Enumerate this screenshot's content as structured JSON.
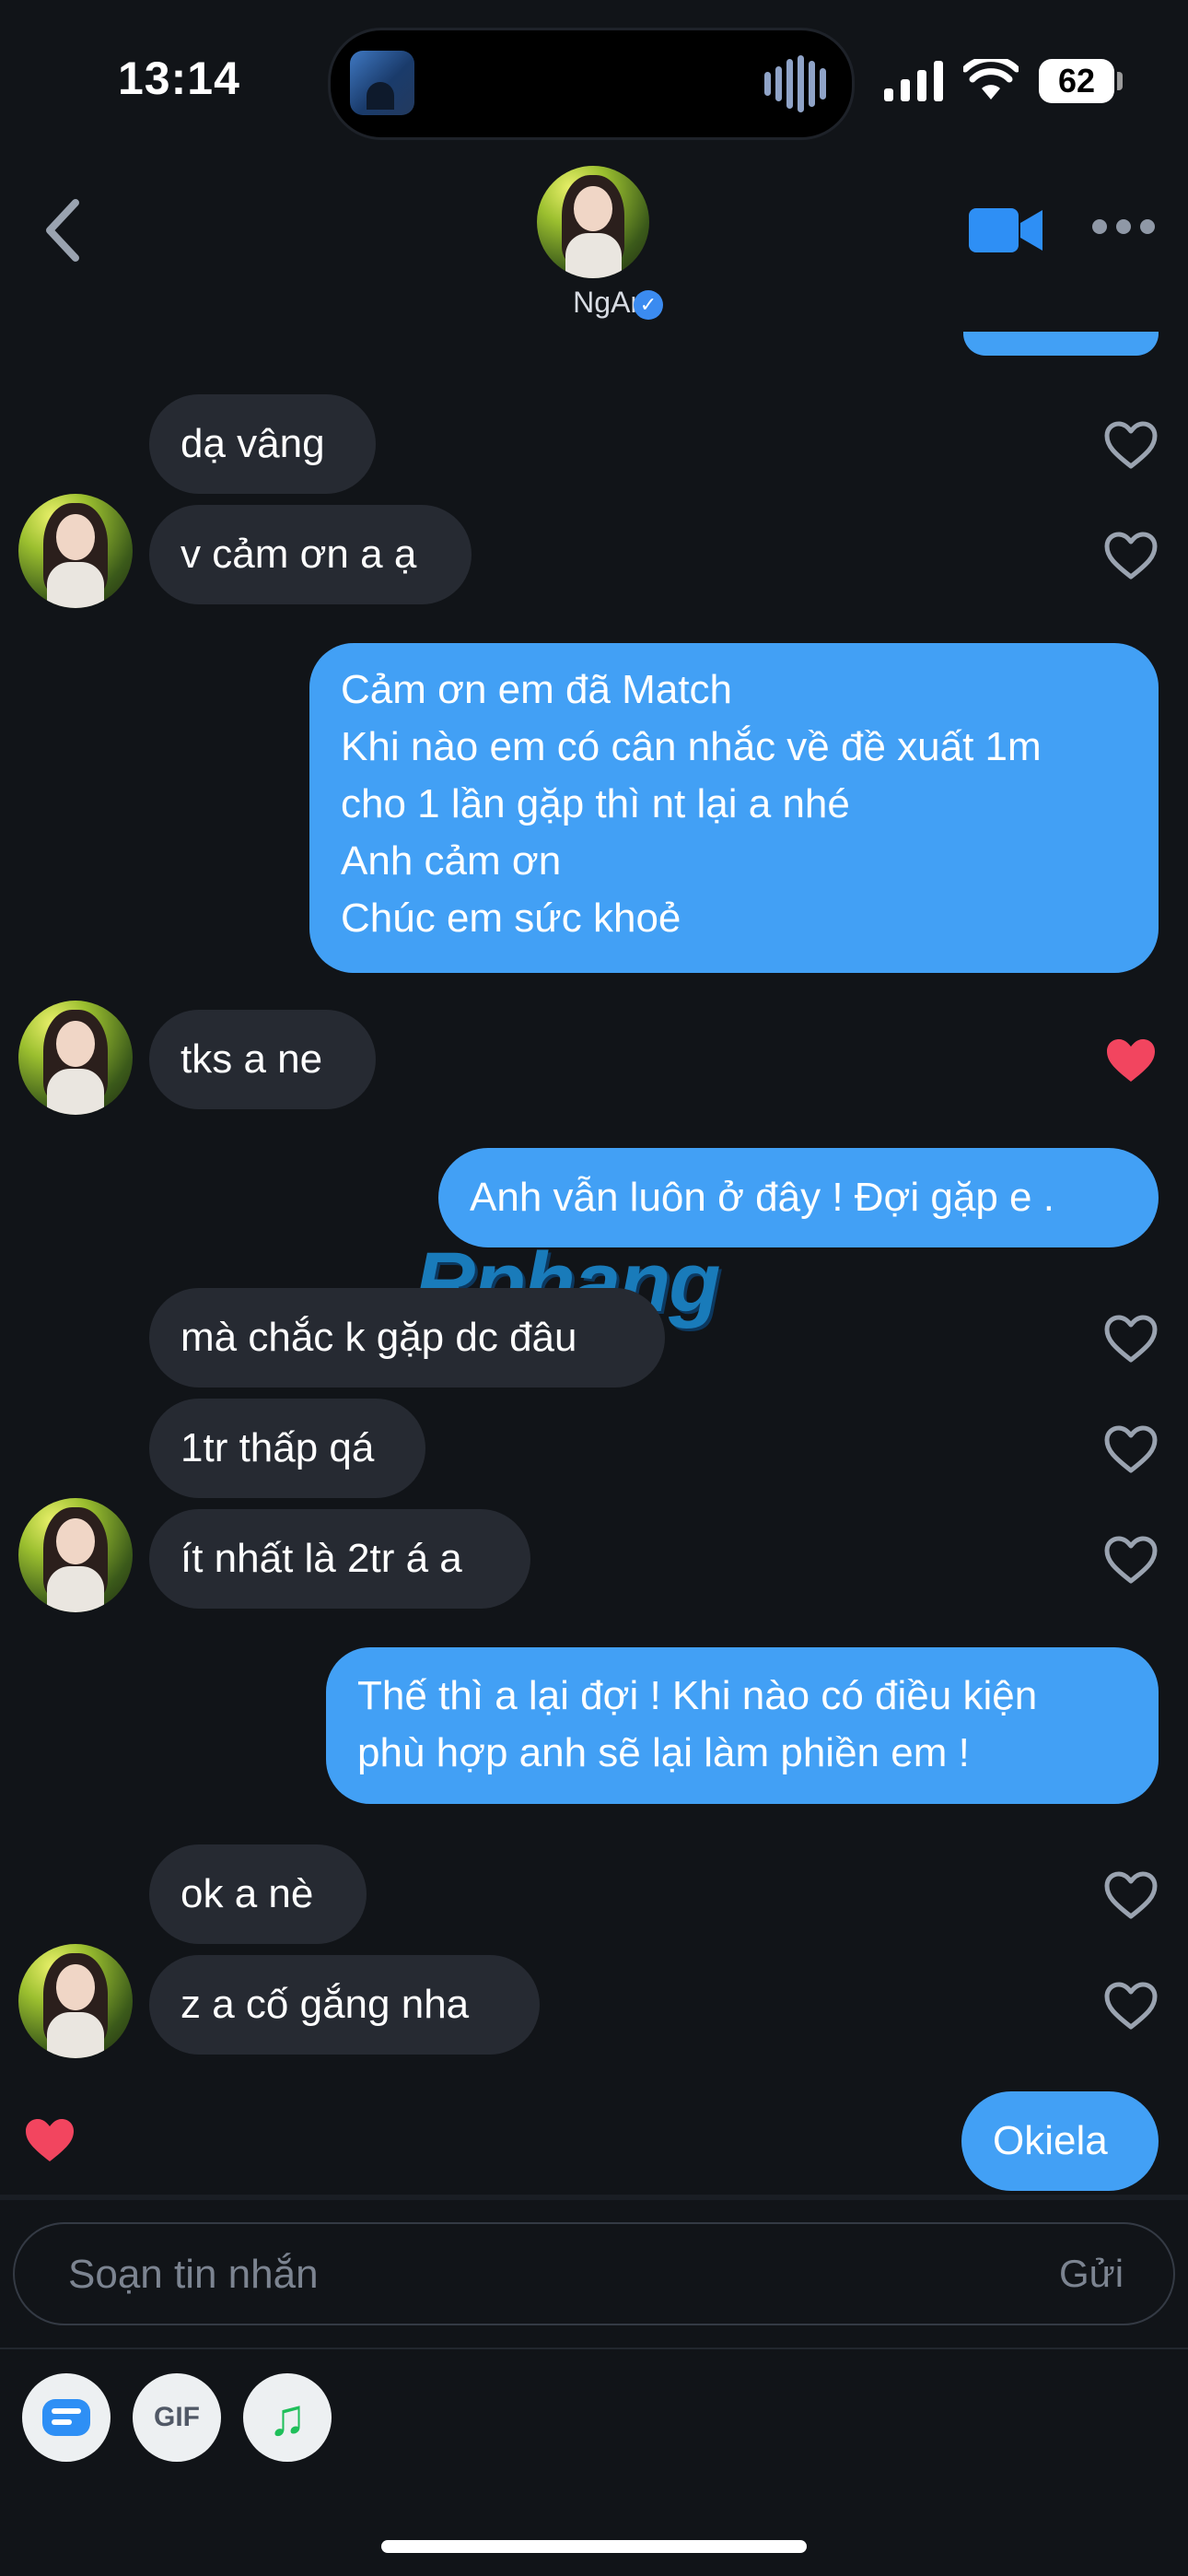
{
  "status_bar": {
    "time": "13:14",
    "battery": "62"
  },
  "header": {
    "contact_name": "NgAnh",
    "verified_glyph": "✓"
  },
  "messages": [
    {
      "side": "in",
      "text": "dạ vâng",
      "liked": false
    },
    {
      "side": "in",
      "text": "v cảm ơn a ạ",
      "liked": false
    },
    {
      "side": "out",
      "text": "Cảm ơn em đã Match\nKhi nào em có cân nhắc về đề xuất 1m\ncho 1 lần gặp thì nt lại a nhé\nAnh cảm ơn\nChúc em sức khoẻ"
    },
    {
      "side": "in",
      "text": "tks a ne",
      "liked": true
    },
    {
      "side": "out",
      "text": "Anh vẫn luôn ở đây ! Đợi gặp e ."
    },
    {
      "side": "in",
      "text": "mà chắc k gặp dc đâu",
      "liked": false
    },
    {
      "side": "in",
      "text": "1tr thấp qá",
      "liked": false
    },
    {
      "side": "in",
      "text": "ít nhất là 2tr á a",
      "liked": false
    },
    {
      "side": "out",
      "text": "Thế thì a lại đợi ! Khi nào có điều kiện\nphù hợp anh sẽ lại làm phiền em !"
    },
    {
      "side": "in",
      "text": "ok a nè",
      "liked": false
    },
    {
      "side": "in",
      "text": "z a cố gắng nha",
      "liked": false
    },
    {
      "side": "out",
      "text": "Okiela",
      "liked_by_other": true
    }
  ],
  "watermark": {
    "part1": "R",
    "part2": "phang"
  },
  "composer": {
    "placeholder": "Soạn tin nhắn",
    "send_label": "Gửi"
  },
  "toolbar": {
    "gif_label": "GIF",
    "music_glyph": "♫"
  },
  "colors": {
    "accent": "#42a0f5",
    "incoming_bubble": "#262a32",
    "heart_liked": "#f2455f",
    "background": "#111418"
  }
}
